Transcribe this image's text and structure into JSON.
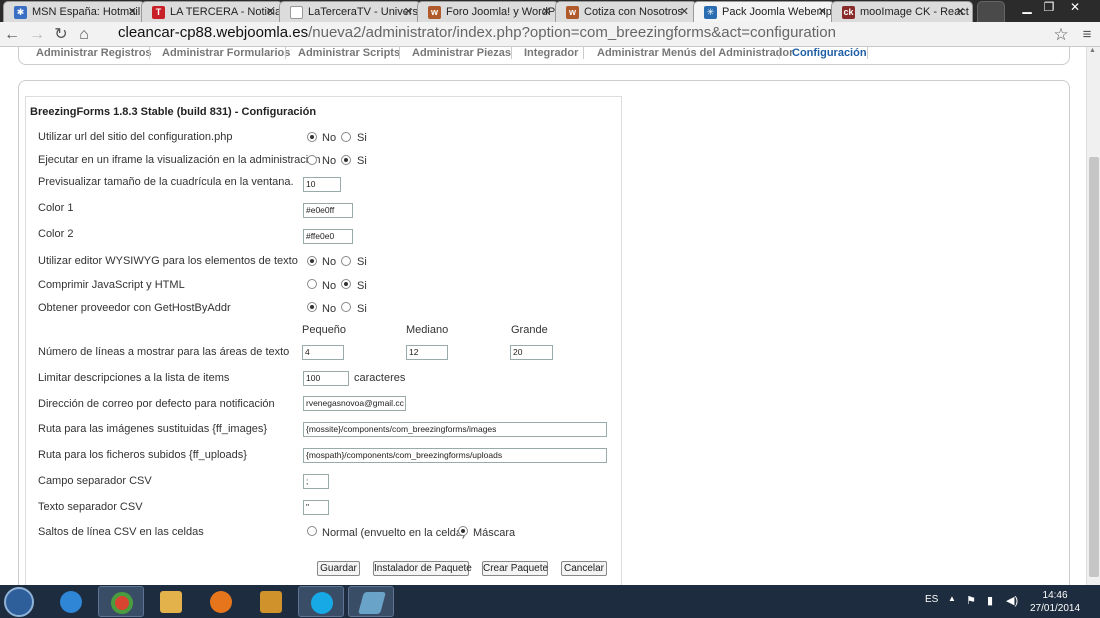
{
  "browser": {
    "tabs": [
      {
        "title": "MSN España: Hotmail",
        "favicon": "msn-butterfly-icon",
        "color": "#3a6fc4",
        "active": false
      },
      {
        "title": "LA TERCERA - Noticias",
        "favicon": "la-tercera-icon",
        "color": "#c82027",
        "active": false
      },
      {
        "title": "LaTerceraTV - Univers",
        "favicon": "page-icon",
        "color": "#9aa6b5",
        "active": false
      },
      {
        "title": "Foro Joomla! y WordP",
        "favicon": "w-icon",
        "color": "#b0592a",
        "active": false
      },
      {
        "title": "Cotiza con Nosotros",
        "favicon": "w-icon",
        "color": "#b0592a",
        "active": false
      },
      {
        "title": "Pack Joomla Webemp",
        "favicon": "joomla-icon",
        "color": "#2a6db0",
        "active": true
      },
      {
        "title": "mooImage CK - React",
        "favicon": "ck-icon",
        "color": "#8a2b2b",
        "active": false
      }
    ],
    "url_host": "cleancar-cp88.webjoomla.es",
    "url_path": "/nueva2/administrator/index.php?option=com_breezingforms&act=configuration"
  },
  "admin_tabs": [
    "Administrar Registros",
    "Administrar Formularios",
    "Administrar Scripts",
    "Administrar Piezas",
    "Integrador",
    "Administrar Menús del Administrador",
    "Configuración"
  ],
  "active_admin_tab": "Configuración",
  "config": {
    "title": "BreezingForms 1.8.3 Stable (build 831) - Configuración",
    "opt_no": "No",
    "opt_si": "Si",
    "rows": {
      "use_site_url": {
        "label": "Utilizar url del sitio del configuration.php",
        "selected": "No"
      },
      "iframe": {
        "label": "Ejecutar en un iframe la visualización en la administración",
        "selected": "Si"
      },
      "grid_size": {
        "label": "Previsualizar tamaño de la cuadrícula en la ventana.",
        "value": "10"
      },
      "color1": {
        "label": "Color 1",
        "value": "#e0e0ff"
      },
      "color2": {
        "label": "Color 2",
        "value": "#ffe0e0"
      },
      "wysiwyg": {
        "label": "Utilizar editor WYSIWYG para los elementos de texto",
        "selected": "No"
      },
      "compress": {
        "label": "Comprimir JavaScript y HTML",
        "selected": "Si"
      },
      "gethost": {
        "label": "Obtener proveedor con GetHostByAddr",
        "selected": "No"
      },
      "lines": {
        "label": "Número de líneas a mostrar para las áreas de texto",
        "head_small": "Pequeño",
        "head_medium": "Mediano",
        "head_large": "Grande",
        "small": "4",
        "medium": "12",
        "large": "20"
      },
      "limit_desc": {
        "label": "Limitar descripciones a la lista de items",
        "value": "100",
        "suffix": "caracteres"
      },
      "email": {
        "label": "Dirección de correo por defecto para notificación",
        "value": "rvenegasnovoa@gmail.cc"
      },
      "images_path": {
        "label": "Ruta para las imágenes sustituidas {ff_images}",
        "value": "{mossite}/components/com_breezingforms/images"
      },
      "uploads_path": {
        "label": "Ruta para los ficheros subidos {ff_uploads}",
        "value": "{mospath}/components/com_breezingforms/uploads"
      },
      "csv_field_sep": {
        "label": "Campo separador CSV",
        "value": ";"
      },
      "csv_text_sep": {
        "label": "Texto separador CSV",
        "value": "\""
      },
      "csv_linebreaks": {
        "label": "Saltos de línea CSV en las celdas",
        "opt_normal": "Normal (envuelto en la celda)",
        "opt_mask": "Máscara",
        "selected": "Máscara"
      }
    },
    "buttons": {
      "save": "Guardar",
      "package_installer": "Instalador de Paquete",
      "create_package": "Crear Paquete",
      "cancel": "Cancelar"
    }
  },
  "taskbar": {
    "apps": [
      {
        "name": "internet-explorer-icon",
        "color": "#2f86d6"
      },
      {
        "name": "chrome-icon",
        "color": "#d8442f"
      },
      {
        "name": "file-explorer-icon",
        "color": "#e3b24a"
      },
      {
        "name": "firefox-icon",
        "color": "#e7751c"
      },
      {
        "name": "media-player-icon",
        "color": "#d0922a"
      },
      {
        "name": "skype-icon",
        "color": "#17a9e6"
      },
      {
        "name": "app-icon",
        "color": "#6aa3c8"
      }
    ],
    "language": "ES",
    "time": "14:46",
    "date": "27/01/2014"
  }
}
